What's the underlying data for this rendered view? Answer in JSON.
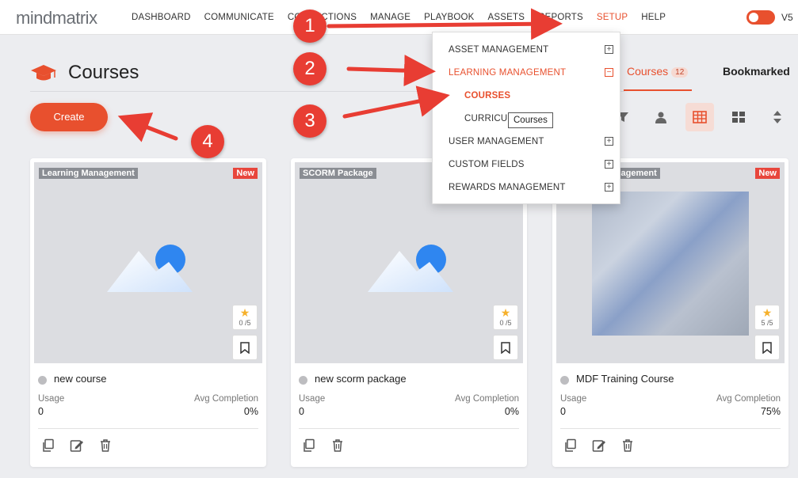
{
  "brand": {
    "logo": "mindmatrix",
    "accent": "#e8502e"
  },
  "nav": {
    "items": [
      "DASHBOARD",
      "COMMUNICATE",
      "CONNECTIONS",
      "MANAGE",
      "PLAYBOOK",
      "ASSETS",
      "REPORTS",
      "SETUP",
      "HELP"
    ],
    "active": "SETUP",
    "version": "V5"
  },
  "page": {
    "title": "Courses",
    "icon": "graduation-cap-icon",
    "create_label": "Create"
  },
  "tabs": {
    "courses_label": "Courses",
    "courses_count": "12",
    "bookmarked_label": "Bookmarked"
  },
  "setup_menu": {
    "items": [
      {
        "label": "ASSET MANAGEMENT",
        "toggle": "+"
      },
      {
        "label": "LEARNING MANAGEMENT",
        "toggle": "−"
      },
      {
        "label": "USER MANAGEMENT",
        "toggle": "+"
      },
      {
        "label": "CUSTOM FIELDS",
        "toggle": "+"
      },
      {
        "label": "REWARDS MANAGEMENT",
        "toggle": "+"
      }
    ],
    "sub_items": [
      "COURSES",
      "CURRICULUM"
    ],
    "tooltip": "Courses"
  },
  "cards": [
    {
      "type": "Learning Management",
      "badge": "New",
      "rating": "0 /5",
      "title": "new course",
      "usage_label": "Usage",
      "usage": "0",
      "avg_label": "Avg Completion",
      "avg": "0%"
    },
    {
      "type": "SCORM Package",
      "badge": "",
      "rating": "0 /5",
      "title": "new scorm package",
      "usage_label": "Usage",
      "usage": "0",
      "avg_label": "Avg Completion",
      "avg": "0%"
    },
    {
      "type": "Learning Management",
      "badge": "New",
      "rating": "5 /5",
      "title": "MDF Training Course",
      "usage_label": "Usage",
      "usage": "0",
      "avg_label": "Avg Completion",
      "avg": "75%"
    }
  ],
  "annotations": {
    "steps": [
      "1",
      "2",
      "3",
      "4"
    ],
    "color": "#e83d33"
  }
}
